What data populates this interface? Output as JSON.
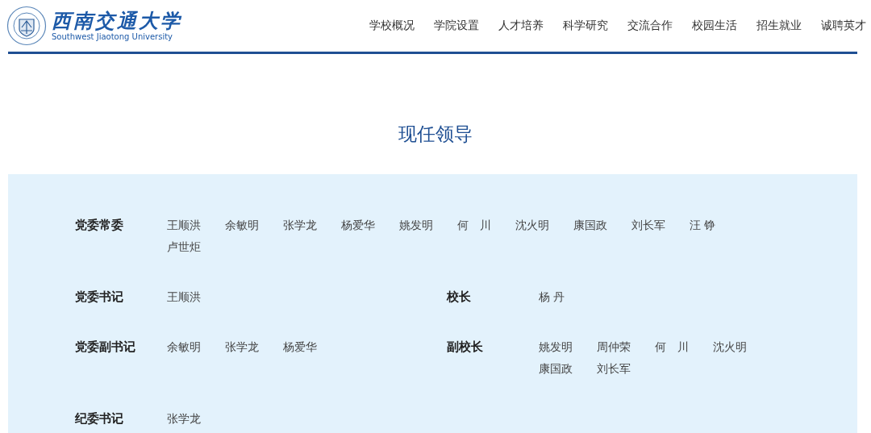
{
  "header": {
    "logo_title": "西南交通大学",
    "logo_subtitle": "Southwest Jiaotong University",
    "nav": [
      "学校概况",
      "学院设置",
      "人才培养",
      "科学研究",
      "交流合作",
      "校园生活",
      "招生就业",
      "诚聘英才"
    ]
  },
  "page_title": "现任领导",
  "rows": [
    {
      "groups": [
        {
          "label": "党委常委",
          "names": [
            "王顺洪",
            "余敏明",
            "张学龙",
            "杨爱华",
            "姚发明",
            "何　川",
            "沈火明",
            "康国政",
            "刘长军",
            "汪 铮",
            "卢世炬"
          ]
        }
      ]
    },
    {
      "groups": [
        {
          "label": "党委书记",
          "names": [
            "王顺洪"
          ]
        },
        {
          "label": "校长",
          "names": [
            "杨 丹"
          ]
        }
      ]
    },
    {
      "groups": [
        {
          "label": "党委副书记",
          "names": [
            "余敏明",
            "张学龙",
            "杨爱华"
          ]
        },
        {
          "label": "副校长",
          "names": [
            "姚发明",
            "周仲荣",
            "何　川",
            "沈火明",
            "康国政",
            "刘长军"
          ]
        }
      ]
    },
    {
      "groups": [
        {
          "label": "纪委书记",
          "names": [
            "张学龙"
          ]
        }
      ]
    }
  ]
}
